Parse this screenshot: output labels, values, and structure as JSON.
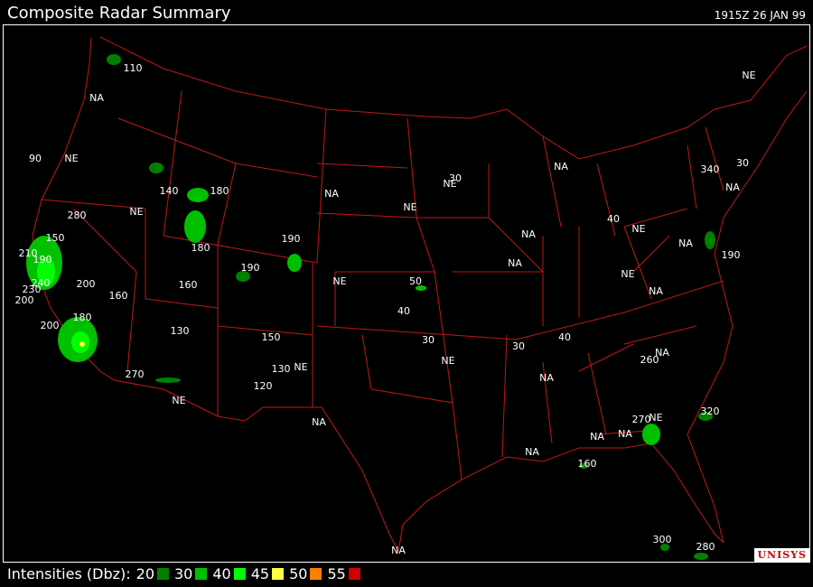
{
  "title": "Composite Radar Summary",
  "datetime": "1915Z 26 JAN 99",
  "logo_text": "UNISYS",
  "legend": {
    "label": "Intensities (Dbz):",
    "items": [
      {
        "value": "20",
        "color": "#008000"
      },
      {
        "value": "30",
        "color": "#00c000"
      },
      {
        "value": "40",
        "color": "#00ff00"
      },
      {
        "value": "45",
        "color": "#ffff40"
      },
      {
        "value": "50",
        "color": "#ff8000"
      },
      {
        "value": "55",
        "color": "#d00000"
      }
    ]
  },
  "colors": {
    "borders": "#c01818",
    "labels": "#ffffff",
    "frame": "#ffffff"
  },
  "map_labels": [
    {
      "id": "l1",
      "text": "110"
    },
    {
      "id": "l2",
      "text": "NA"
    },
    {
      "id": "l3",
      "text": "NE"
    },
    {
      "id": "l4",
      "text": "90"
    },
    {
      "id": "l5",
      "text": "NE"
    },
    {
      "id": "l6",
      "text": "140"
    },
    {
      "id": "l7",
      "text": "180"
    },
    {
      "id": "l8",
      "text": "NE"
    },
    {
      "id": "l9",
      "text": "280"
    },
    {
      "id": "l10",
      "text": "150"
    },
    {
      "id": "l11",
      "text": "210"
    },
    {
      "id": "l12",
      "text": "190"
    },
    {
      "id": "l13",
      "text": "240"
    },
    {
      "id": "l14",
      "text": "230"
    },
    {
      "id": "l15",
      "text": "200"
    },
    {
      "id": "l16",
      "text": "200"
    },
    {
      "id": "l17",
      "text": "160"
    },
    {
      "id": "l18",
      "text": "180"
    },
    {
      "id": "l19",
      "text": "200"
    },
    {
      "id": "l20",
      "text": "180"
    },
    {
      "id": "l21",
      "text": "160"
    },
    {
      "id": "l22",
      "text": "190"
    },
    {
      "id": "l23",
      "text": "190"
    },
    {
      "id": "l24",
      "text": "130"
    },
    {
      "id": "l25",
      "text": "270"
    },
    {
      "id": "l26",
      "text": "NE"
    },
    {
      "id": "l27",
      "text": "150"
    },
    {
      "id": "l28",
      "text": "130"
    },
    {
      "id": "l29",
      "text": "120"
    },
    {
      "id": "l30",
      "text": "NE"
    },
    {
      "id": "l31",
      "text": "NA"
    },
    {
      "id": "l32",
      "text": "NA"
    },
    {
      "id": "l33",
      "text": "NE"
    },
    {
      "id": "l34",
      "text": "NE"
    },
    {
      "id": "l35",
      "text": "50"
    },
    {
      "id": "l36",
      "text": "40"
    },
    {
      "id": "l37",
      "text": "30"
    },
    {
      "id": "l38",
      "text": "NE"
    },
    {
      "id": "l39",
      "text": "NE"
    },
    {
      "id": "l40",
      "text": "30"
    },
    {
      "id": "l41",
      "text": "NA"
    },
    {
      "id": "l42",
      "text": "NA"
    },
    {
      "id": "l43",
      "text": "NA"
    },
    {
      "id": "l44",
      "text": "40"
    },
    {
      "id": "l45",
      "text": "NE"
    },
    {
      "id": "l46",
      "text": "NE"
    },
    {
      "id": "l47",
      "text": "NA"
    },
    {
      "id": "l48",
      "text": "30"
    },
    {
      "id": "l49",
      "text": "40"
    },
    {
      "id": "l50",
      "text": "NA"
    },
    {
      "id": "l51",
      "text": "NA"
    },
    {
      "id": "l52",
      "text": "160"
    },
    {
      "id": "l53",
      "text": "NA"
    },
    {
      "id": "l54",
      "text": "270"
    },
    {
      "id": "l55",
      "text": "260"
    },
    {
      "id": "l56",
      "text": "NA"
    },
    {
      "id": "l57",
      "text": "320"
    },
    {
      "id": "l58",
      "text": "NA"
    },
    {
      "id": "l59",
      "text": "190"
    },
    {
      "id": "l60",
      "text": "NA"
    },
    {
      "id": "l61",
      "text": "340"
    },
    {
      "id": "l62",
      "text": "30"
    },
    {
      "id": "l63",
      "text": "NA"
    },
    {
      "id": "l64",
      "text": "NE"
    },
    {
      "id": "l65",
      "text": "300"
    },
    {
      "id": "l66",
      "text": "280"
    },
    {
      "id": "l67",
      "text": "NA"
    }
  ]
}
